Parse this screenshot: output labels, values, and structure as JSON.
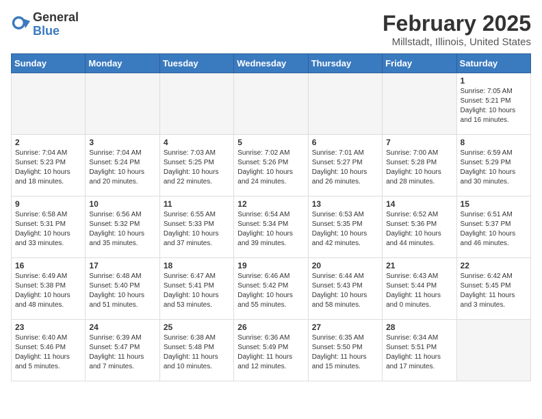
{
  "app": {
    "name_general": "General",
    "name_blue": "Blue"
  },
  "header": {
    "month": "February 2025",
    "location": "Millstadt, Illinois, United States"
  },
  "weekdays": [
    "Sunday",
    "Monday",
    "Tuesday",
    "Wednesday",
    "Thursday",
    "Friday",
    "Saturday"
  ],
  "weeks": [
    [
      {
        "day": "",
        "info": ""
      },
      {
        "day": "",
        "info": ""
      },
      {
        "day": "",
        "info": ""
      },
      {
        "day": "",
        "info": ""
      },
      {
        "day": "",
        "info": ""
      },
      {
        "day": "",
        "info": ""
      },
      {
        "day": "1",
        "info": "Sunrise: 7:05 AM\nSunset: 5:21 PM\nDaylight: 10 hours and 16 minutes."
      }
    ],
    [
      {
        "day": "2",
        "info": "Sunrise: 7:04 AM\nSunset: 5:23 PM\nDaylight: 10 hours and 18 minutes."
      },
      {
        "day": "3",
        "info": "Sunrise: 7:04 AM\nSunset: 5:24 PM\nDaylight: 10 hours and 20 minutes."
      },
      {
        "day": "4",
        "info": "Sunrise: 7:03 AM\nSunset: 5:25 PM\nDaylight: 10 hours and 22 minutes."
      },
      {
        "day": "5",
        "info": "Sunrise: 7:02 AM\nSunset: 5:26 PM\nDaylight: 10 hours and 24 minutes."
      },
      {
        "day": "6",
        "info": "Sunrise: 7:01 AM\nSunset: 5:27 PM\nDaylight: 10 hours and 26 minutes."
      },
      {
        "day": "7",
        "info": "Sunrise: 7:00 AM\nSunset: 5:28 PM\nDaylight: 10 hours and 28 minutes."
      },
      {
        "day": "8",
        "info": "Sunrise: 6:59 AM\nSunset: 5:29 PM\nDaylight: 10 hours and 30 minutes."
      }
    ],
    [
      {
        "day": "9",
        "info": "Sunrise: 6:58 AM\nSunset: 5:31 PM\nDaylight: 10 hours and 33 minutes."
      },
      {
        "day": "10",
        "info": "Sunrise: 6:56 AM\nSunset: 5:32 PM\nDaylight: 10 hours and 35 minutes."
      },
      {
        "day": "11",
        "info": "Sunrise: 6:55 AM\nSunset: 5:33 PM\nDaylight: 10 hours and 37 minutes."
      },
      {
        "day": "12",
        "info": "Sunrise: 6:54 AM\nSunset: 5:34 PM\nDaylight: 10 hours and 39 minutes."
      },
      {
        "day": "13",
        "info": "Sunrise: 6:53 AM\nSunset: 5:35 PM\nDaylight: 10 hours and 42 minutes."
      },
      {
        "day": "14",
        "info": "Sunrise: 6:52 AM\nSunset: 5:36 PM\nDaylight: 10 hours and 44 minutes."
      },
      {
        "day": "15",
        "info": "Sunrise: 6:51 AM\nSunset: 5:37 PM\nDaylight: 10 hours and 46 minutes."
      }
    ],
    [
      {
        "day": "16",
        "info": "Sunrise: 6:49 AM\nSunset: 5:38 PM\nDaylight: 10 hours and 48 minutes."
      },
      {
        "day": "17",
        "info": "Sunrise: 6:48 AM\nSunset: 5:40 PM\nDaylight: 10 hours and 51 minutes."
      },
      {
        "day": "18",
        "info": "Sunrise: 6:47 AM\nSunset: 5:41 PM\nDaylight: 10 hours and 53 minutes."
      },
      {
        "day": "19",
        "info": "Sunrise: 6:46 AM\nSunset: 5:42 PM\nDaylight: 10 hours and 55 minutes."
      },
      {
        "day": "20",
        "info": "Sunrise: 6:44 AM\nSunset: 5:43 PM\nDaylight: 10 hours and 58 minutes."
      },
      {
        "day": "21",
        "info": "Sunrise: 6:43 AM\nSunset: 5:44 PM\nDaylight: 11 hours and 0 minutes."
      },
      {
        "day": "22",
        "info": "Sunrise: 6:42 AM\nSunset: 5:45 PM\nDaylight: 11 hours and 3 minutes."
      }
    ],
    [
      {
        "day": "23",
        "info": "Sunrise: 6:40 AM\nSunset: 5:46 PM\nDaylight: 11 hours and 5 minutes."
      },
      {
        "day": "24",
        "info": "Sunrise: 6:39 AM\nSunset: 5:47 PM\nDaylight: 11 hours and 7 minutes."
      },
      {
        "day": "25",
        "info": "Sunrise: 6:38 AM\nSunset: 5:48 PM\nDaylight: 11 hours and 10 minutes."
      },
      {
        "day": "26",
        "info": "Sunrise: 6:36 AM\nSunset: 5:49 PM\nDaylight: 11 hours and 12 minutes."
      },
      {
        "day": "27",
        "info": "Sunrise: 6:35 AM\nSunset: 5:50 PM\nDaylight: 11 hours and 15 minutes."
      },
      {
        "day": "28",
        "info": "Sunrise: 6:34 AM\nSunset: 5:51 PM\nDaylight: 11 hours and 17 minutes."
      },
      {
        "day": "",
        "info": ""
      }
    ]
  ]
}
